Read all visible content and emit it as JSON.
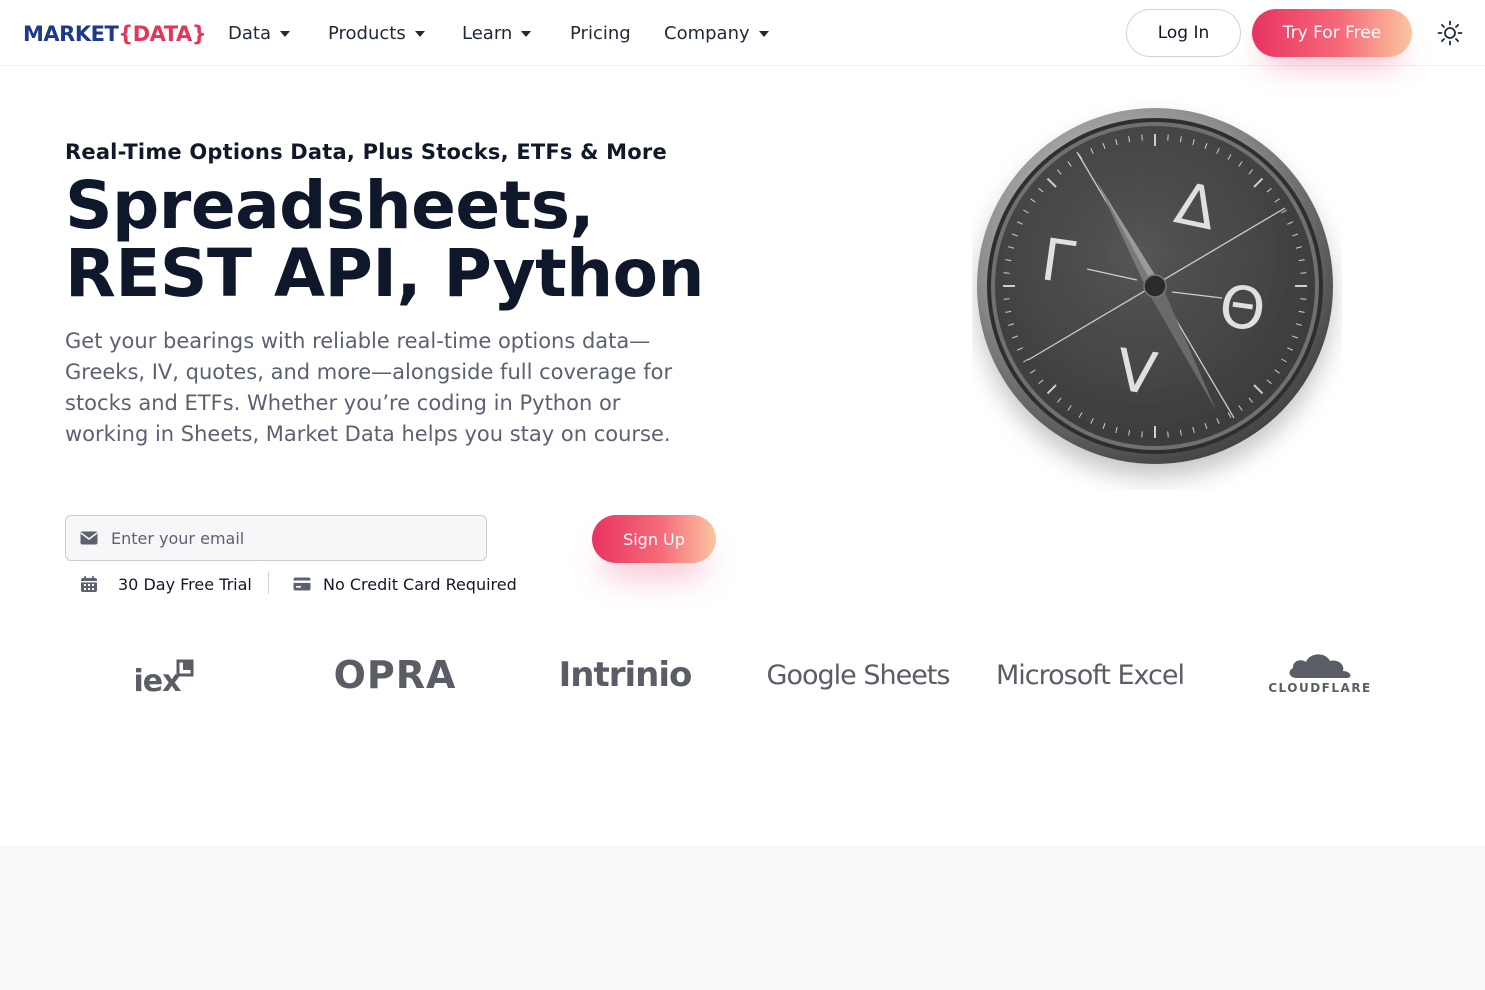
{
  "brand": {
    "part1": "MARKET",
    "part2": "{DATA}"
  },
  "nav": {
    "items": [
      {
        "label": "Data",
        "has_menu": true
      },
      {
        "label": "Products",
        "has_menu": true
      },
      {
        "label": "Learn",
        "has_menu": true
      },
      {
        "label": "Pricing",
        "has_menu": false
      },
      {
        "label": "Company",
        "has_menu": true
      }
    ],
    "login_label": "Log In",
    "try_label": "Try For Free",
    "theme_icon": "sun-icon"
  },
  "hero": {
    "eyebrow": "Real-Time Options Data, Plus Stocks, ETFs & More",
    "headline_line1": "Spreadsheets,",
    "headline_line2": "REST API, Python",
    "lead": "Get your bearings with reliable real-time options data—Greeks, IV, quotes, and more—alongside full coverage for stocks and ETFs. Whether you’re coding in Python or working in Sheets, Market Data helps you stay on course.",
    "email_placeholder": "Enter your email",
    "email_value": "",
    "signup_label": "Sign Up",
    "perks": [
      {
        "icon": "calendar-icon",
        "label": "30 Day Free Trial"
      },
      {
        "icon": "credit-card-icon",
        "label": "No Credit Card Required"
      }
    ],
    "compass_glyphs": [
      "Δ",
      "Γ",
      "Θ",
      "V"
    ]
  },
  "partners": [
    {
      "name": "iex"
    },
    {
      "name": "OPRA"
    },
    {
      "name": "Intrinio"
    },
    {
      "name": "Google Sheets"
    },
    {
      "name": "Microsoft Excel"
    },
    {
      "name": "CLOUDFLARE"
    }
  ],
  "colors": {
    "brand_navy": "#1e3a8a",
    "brand_pink": "#e2365b",
    "gradient_start": "#e83360",
    "gradient_end": "#fbc6a0",
    "logo_gray": "#5a5d66"
  }
}
